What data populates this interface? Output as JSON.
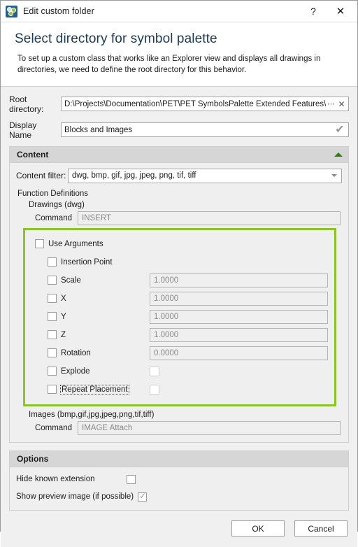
{
  "titlebar": {
    "app_icon": "app-logo-icon",
    "title": "Edit custom folder",
    "help_label": "?",
    "close_label": "✕"
  },
  "header": {
    "title": "Select directory for symbol palette",
    "description": "To set up a custom class that works like an Explorer view and displays all drawings in directories, we need to define the root directory for this behavior."
  },
  "root_directory": {
    "label": "Root directory:",
    "value": "D:\\Projects\\Documentation\\PET\\PET SymbolsPalette Extended Features\\Blocks",
    "browse_label": "⋯",
    "clear_label": "✕"
  },
  "display_name": {
    "label": "Display Name",
    "value": "Blocks and Images",
    "validation_mark": "✔"
  },
  "content": {
    "group_title": "Content",
    "collapse_state": "expanded",
    "filter": {
      "label": "Content filter:",
      "value": "dwg, bmp, gif, jpg, jpeg, png, tif, tiff"
    },
    "function_definitions_label": "Function Definitions",
    "drawings": {
      "section_label": "Drawings (dwg)",
      "command_label": "Command",
      "command_value": "INSERT",
      "use_arguments": {
        "label": "Use Arguments",
        "checked": false
      },
      "arguments": [
        {
          "label": "Insertion Point",
          "checked": false,
          "value": null,
          "type": "none"
        },
        {
          "label": "Scale",
          "checked": false,
          "value": "1.0000",
          "type": "text"
        },
        {
          "label": "X",
          "checked": false,
          "value": "1.0000",
          "type": "text"
        },
        {
          "label": "Y",
          "checked": false,
          "value": "1.0000",
          "type": "text"
        },
        {
          "label": "Z",
          "checked": false,
          "value": "1.0000",
          "type": "text"
        },
        {
          "label": "Rotation",
          "checked": false,
          "value": "0.0000",
          "type": "text"
        },
        {
          "label": "Explode",
          "checked": false,
          "value": null,
          "type": "checkbox"
        },
        {
          "label": "Repeat Placement",
          "checked": false,
          "value": null,
          "type": "checkbox",
          "focused": true
        }
      ]
    },
    "images": {
      "section_label": "Images (bmp,gif,jpg,jpeg,png,tif,tiff)",
      "command_label": "Command",
      "command_value": "IMAGE Attach"
    }
  },
  "options": {
    "group_title": "Options",
    "items": [
      {
        "label": "Hide known extension",
        "checked": false
      },
      {
        "label": "Show preview image (if possible)",
        "checked": true
      }
    ]
  },
  "footer": {
    "ok_label": "OK",
    "cancel_label": "Cancel"
  },
  "colors": {
    "accent_green": "#8cc428",
    "collapse_arrow_green": "#2e7d0f",
    "title_blue": "#1d3a53",
    "group_header_bg": "#d6d6d6",
    "body_bg": "#f0f0f0"
  }
}
